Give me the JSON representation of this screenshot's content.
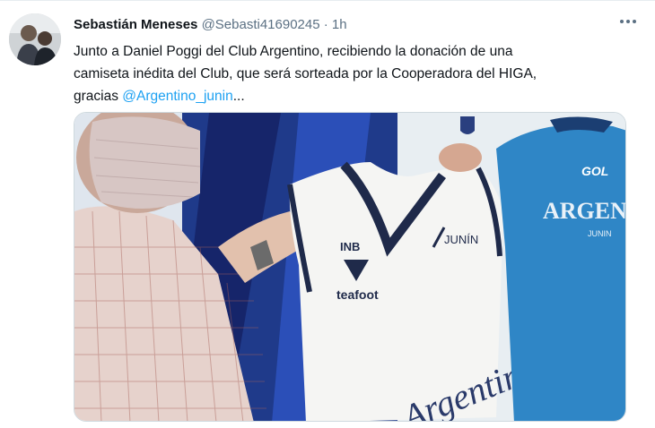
{
  "tweet": {
    "display_name": "Sebastián Meneses",
    "handle": "@Sebasti41690245",
    "separator": "·",
    "time": "1h",
    "text_line1": "Junto a Daniel Poggi del Club Argentino, recibiendo la donación de una",
    "text_line2": "camiseta inédita del Club, que será sorteada por la Cooperadora del HIGA,",
    "text_line3_prefix": "gracias ",
    "mention": "@Argentino_junin",
    "ellipsis": "..."
  },
  "media": {
    "jersey_brand_top": "INB",
    "jersey_brand": "teafoot",
    "jersey_sponsor": "JUNÍN",
    "jersey_wordmark": "Argentino",
    "shirt_brand": "GOL",
    "shirt_text": "ARGEN",
    "shirt_subtext": "JUNIN"
  },
  "colors": {
    "link": "#1da1f2",
    "secondary_text": "#5b7083",
    "navy": "#1f2a4a",
    "blue_shirt": "#2f86c6"
  },
  "icons": {
    "more": "more-horizontal-icon"
  }
}
